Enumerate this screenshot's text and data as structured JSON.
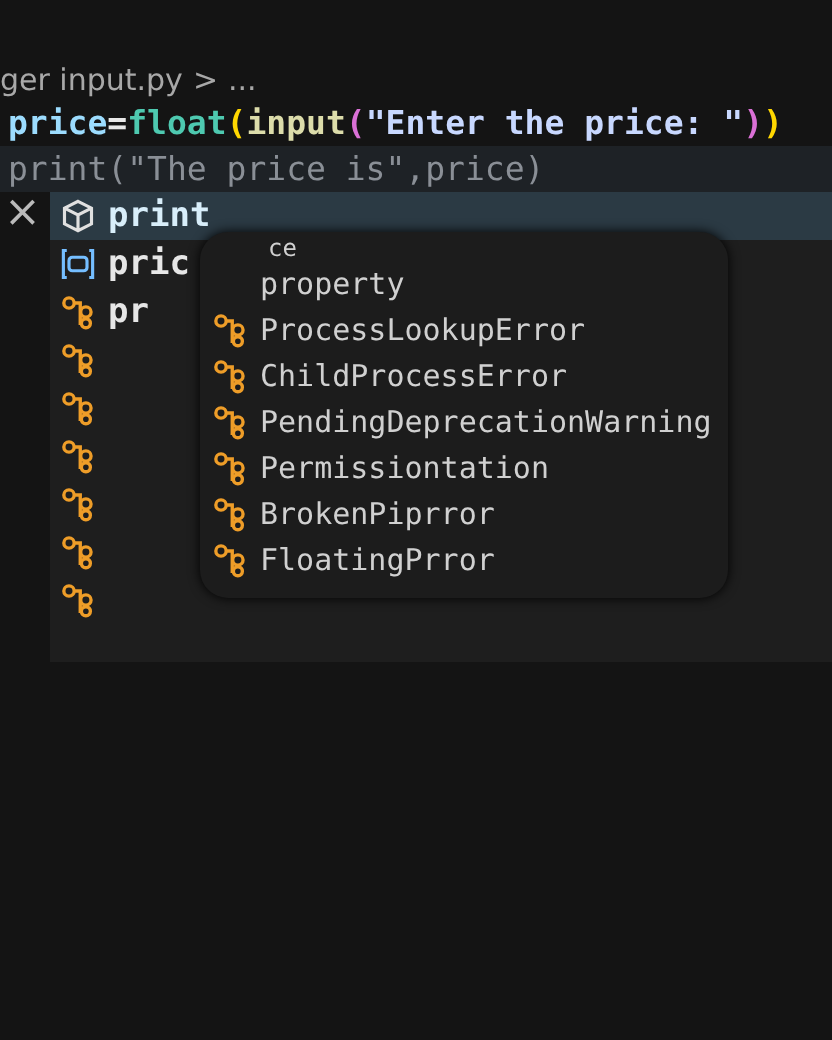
{
  "breadcrumb": {
    "path": "ger input.py",
    "separator": ">",
    "more": "..."
  },
  "code_lines": [
    {
      "tokens": [
        {
          "text": "price",
          "kind": "var"
        },
        {
          "text": "=",
          "kind": "op"
        },
        {
          "text": "float",
          "kind": "type"
        },
        {
          "text": "(",
          "kind": "paren1"
        },
        {
          "text": "input",
          "kind": "func"
        },
        {
          "text": "(",
          "kind": "paren2"
        },
        {
          "text": "\"Enter the price: \"",
          "kind": "string"
        },
        {
          "text": ")",
          "kind": "paren2"
        },
        {
          "text": ")",
          "kind": "paren1"
        }
      ],
      "dimmed": false
    },
    {
      "tokens": [
        {
          "text": "print",
          "kind": "plain"
        },
        {
          "text": "(\"The price is\",price)",
          "kind": "plain"
        }
      ],
      "dimmed": true
    }
  ],
  "suggest": {
    "close": "×",
    "items": [
      {
        "label": "print",
        "kind": "module",
        "selected": true
      },
      {
        "label": "pric",
        "kind": "variable",
        "selected": false
      },
      {
        "label": "pr",
        "kind": "class",
        "selected": false
      },
      {
        "kind": "class",
        "selected": false
      },
      {
        "kind": "class",
        "selected": false
      },
      {
        "kind": "class",
        "selected": false
      },
      {
        "kind": "class",
        "selected": false
      },
      {
        "kind": "class",
        "selected": false
      },
      {
        "kind": "class",
        "selected": false
      }
    ]
  },
  "overlay_suggest": {
    "items": [
      {
        "label": "ce",
        "kind": "text"
      },
      {
        "label": "property",
        "kind": "text"
      },
      {
        "label": "ProcessLookupError",
        "kind": "class"
      },
      {
        "label": "ChildProcessError",
        "kind": "class"
      },
      {
        "label": "PendingDeprecationWarning",
        "kind": "class"
      },
      {
        "label": "Permissiontation",
        "kind": "class"
      },
      {
        "label": "BrokenPiprror",
        "kind": "class"
      },
      {
        "label": "FloatingPrror",
        "kind": "class"
      }
    ]
  }
}
